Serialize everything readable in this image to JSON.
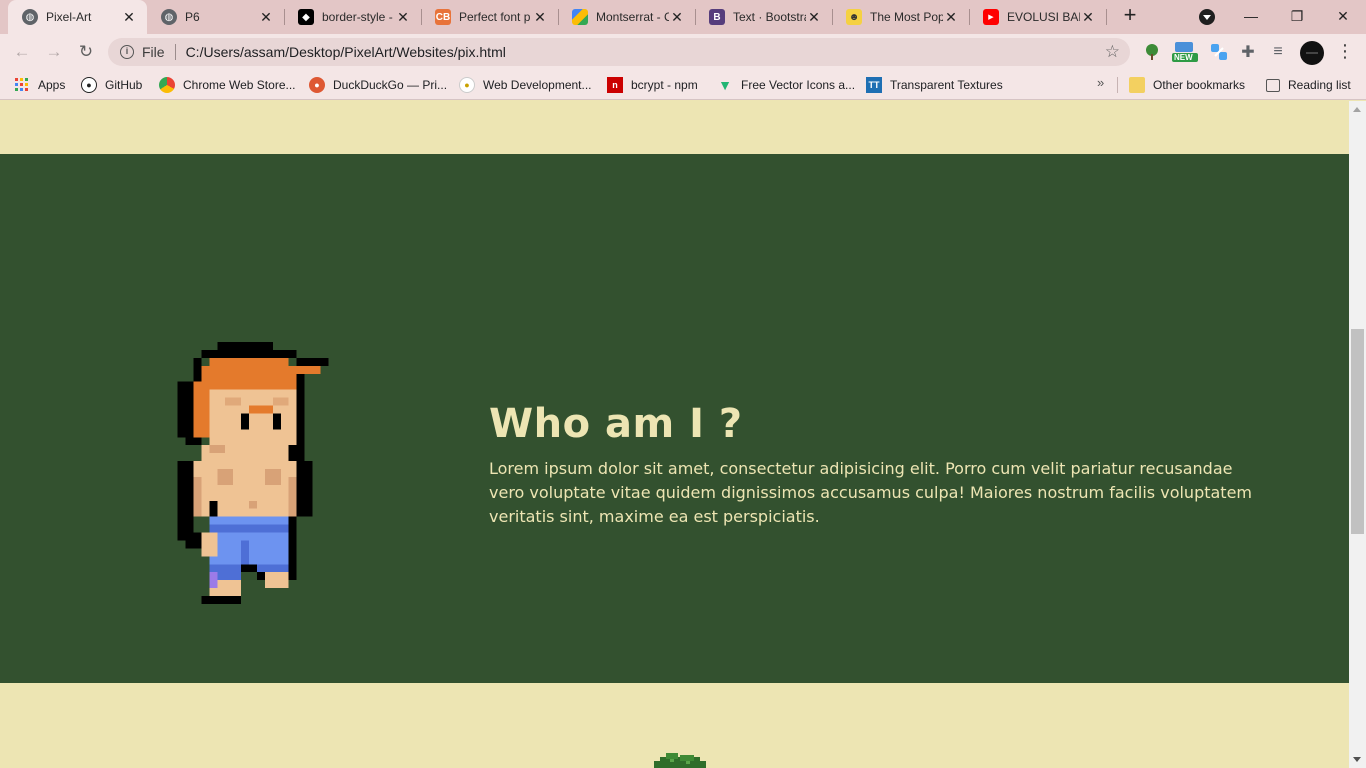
{
  "tabs": [
    {
      "title": "Pixel-Art",
      "icon": "globe-icon",
      "active": true,
      "color": "#5f6368"
    },
    {
      "title": "P6",
      "icon": "globe-icon",
      "active": false,
      "color": "#5f6368"
    },
    {
      "title": "border-style - ",
      "icon": "codepen-icon",
      "active": false,
      "color": "#000000"
    },
    {
      "title": "Perfect font p",
      "icon": "cssbuttons-icon",
      "active": false,
      "color": "#e8733a"
    },
    {
      "title": "Montserrat - C",
      "icon": "google-fonts-icon",
      "active": false,
      "color": "#4285f4"
    },
    {
      "title": "Text · Bootstra",
      "icon": "bootstrap-icon",
      "active": false,
      "color": "#563d7c"
    },
    {
      "title": "The Most Pop",
      "icon": "mask-icon",
      "active": false,
      "color": "#333333"
    },
    {
      "title": "EVOLUSI BAN",
      "icon": "youtube-icon",
      "active": false,
      "color": "#ff0000"
    }
  ],
  "toolbar": {
    "url_scheme_label": "File",
    "url": "C:/Users/assam/Desktop/PixelArt/Websites/pix.html",
    "extension_badge": "NEW"
  },
  "bookmarks": [
    {
      "label": "Apps",
      "icon": "apps-grid-icon"
    },
    {
      "label": "GitHub",
      "icon": "github-icon"
    },
    {
      "label": "Chrome Web Store...",
      "icon": "chrome-web-store-icon"
    },
    {
      "label": "DuckDuckGo — Pri...",
      "icon": "duckduckgo-icon"
    },
    {
      "label": "Web Development...",
      "icon": "web-dev-icon"
    },
    {
      "label": "bcrypt - npm",
      "icon": "npm-icon"
    },
    {
      "label": "Free Vector Icons a...",
      "icon": "vector-icons-icon"
    },
    {
      "label": "Transparent Textures",
      "icon": "transparent-textures-icon"
    }
  ],
  "bookmarks_right": {
    "other": "Other bookmarks",
    "reading_list": "Reading list"
  },
  "page": {
    "heading": "Who am I ?",
    "body": "Lorem ipsum dolor sit amet, consectetur adipisicing elit. Porro cum velit pariatur recusandae vero voluptate vitae quidem dignissimos accusamus culpa! Maiores nostrum facilis voluptatem veritatis sint, maxime ea est perspiciatis."
  },
  "colors": {
    "page_background": "#ede5b3",
    "hero_background": "#33512f",
    "hero_text": "#ede5b3",
    "tab_strip": "#e3c6c6",
    "toolbar": "#f4e6e6"
  }
}
